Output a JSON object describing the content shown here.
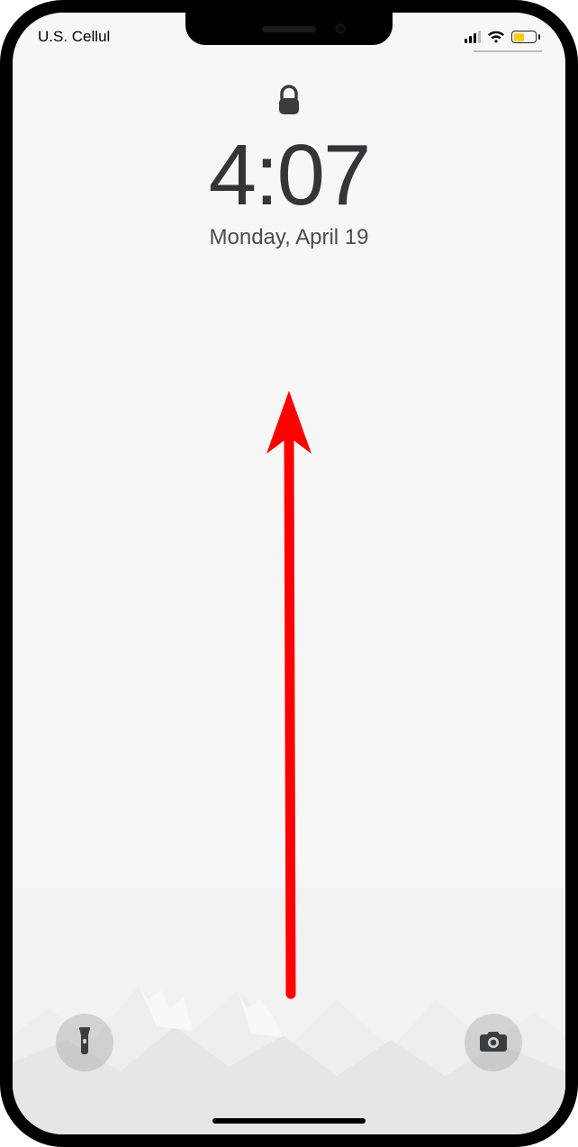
{
  "status": {
    "carrier": "U.S. Cellul",
    "signal_bars": 3,
    "wifi": true,
    "battery_level_pct": 50,
    "battery_color": "#ffcc00"
  },
  "lockscreen": {
    "time": "4:07",
    "date": "Monday, April 19"
  },
  "quick_actions": {
    "flashlight_label": "Flashlight",
    "camera_label": "Camera"
  },
  "annotation": {
    "description": "swipe-up gesture arrow",
    "color": "#ff0000"
  }
}
